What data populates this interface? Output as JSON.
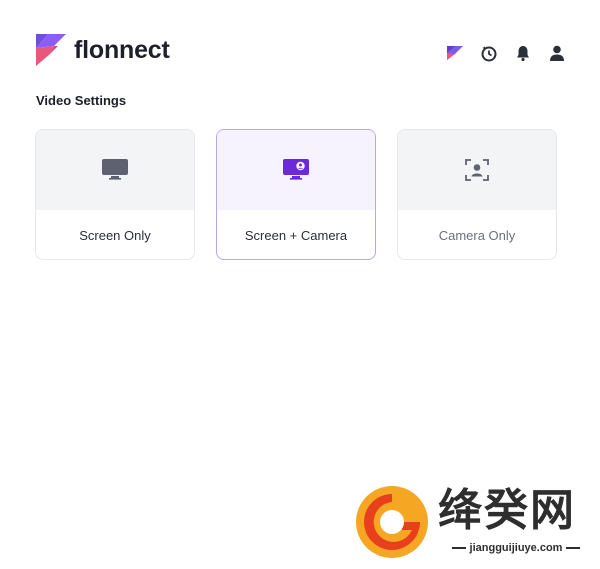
{
  "brand": {
    "name": "flonnect",
    "colors": {
      "purple": "#7c3aed",
      "pink": "#e8587a",
      "violet": "#6d4fd8"
    }
  },
  "header_icons": [
    "flonnect-mini-icon",
    "history-icon",
    "bell-icon",
    "user-icon"
  ],
  "section": {
    "title": "Video Settings"
  },
  "options": [
    {
      "label": "Screen Only",
      "icon": "monitor-icon",
      "selected": false
    },
    {
      "label": "Screen + Camera",
      "icon": "monitor-camera-icon",
      "selected": true
    },
    {
      "label": "Camera Only",
      "icon": "camera-frame-icon",
      "selected": false
    }
  ],
  "watermark": {
    "cn": "绛癸网",
    "url": "jiangguijiuye.com"
  }
}
